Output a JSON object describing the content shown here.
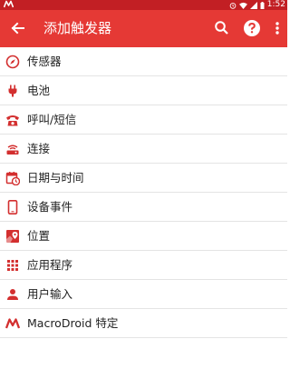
{
  "status_bar": {
    "time": "1:52"
  },
  "app_bar": {
    "title": "添加触发器"
  },
  "colors": {
    "status_bar": "#c21f24",
    "app_bar": "#e53935",
    "accent_icon": "#d32f2f"
  },
  "items": [
    {
      "label": "传感器",
      "icon": "compass-icon"
    },
    {
      "label": "电池",
      "icon": "power-plug-icon"
    },
    {
      "label": "呼叫/短信",
      "icon": "phone-icon"
    },
    {
      "label": "连接",
      "icon": "router-icon"
    },
    {
      "label": "日期与时间",
      "icon": "calendar-clock-icon"
    },
    {
      "label": "设备事件",
      "icon": "device-icon"
    },
    {
      "label": "位置",
      "icon": "map-pin-icon"
    },
    {
      "label": "应用程序",
      "icon": "apps-grid-icon"
    },
    {
      "label": "用户输入",
      "icon": "person-icon"
    },
    {
      "label": "MacroDroid 特定",
      "icon": "macrodroid-logo-icon"
    }
  ]
}
